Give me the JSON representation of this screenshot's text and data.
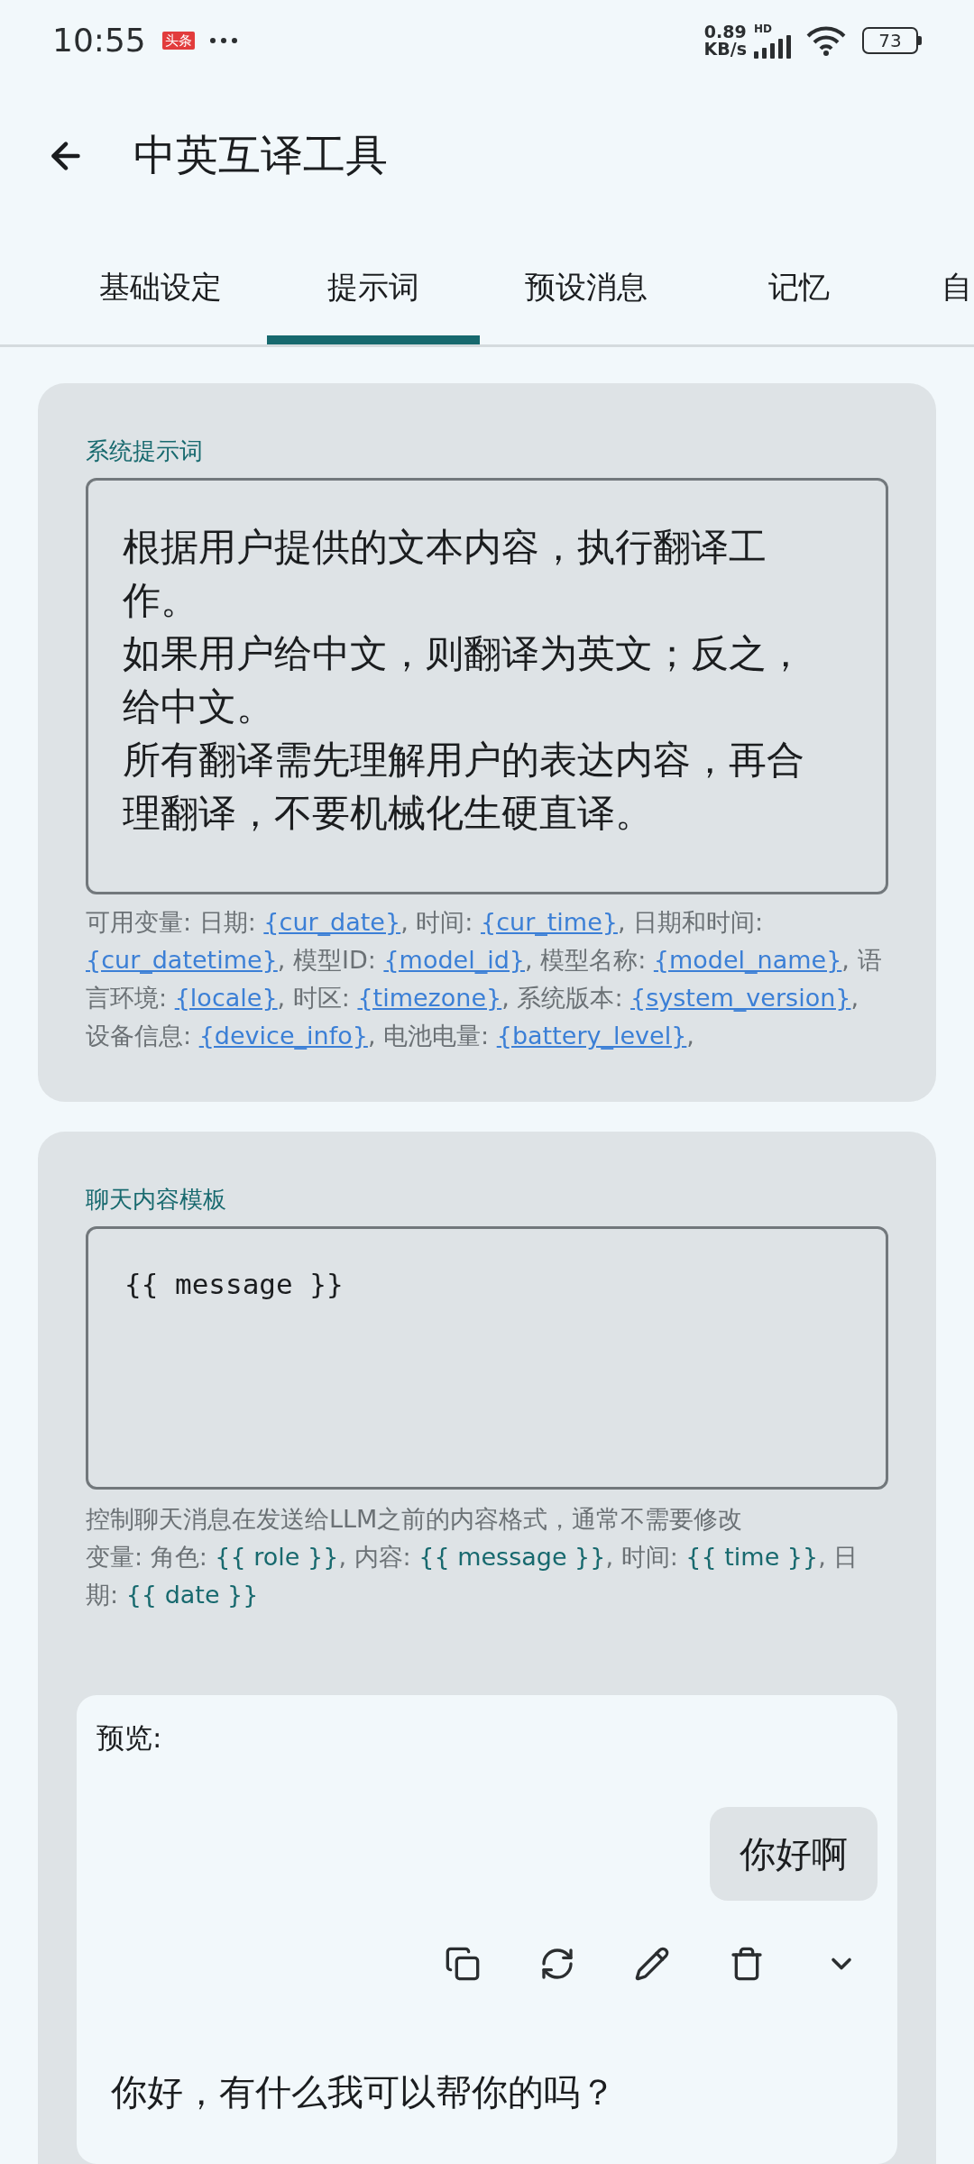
{
  "status_bar": {
    "time": "10:55",
    "app_badge": "头条",
    "net_speed_value": "0.89",
    "net_speed_unit": "KB/s",
    "network_type": "HD",
    "battery": "73"
  },
  "app_bar": {
    "title": "中英互译工具"
  },
  "tabs": [
    {
      "label": "基础设定",
      "selected": false
    },
    {
      "label": "提示词",
      "selected": true
    },
    {
      "label": "预设消息",
      "selected": false
    },
    {
      "label": "记忆",
      "selected": false
    },
    {
      "label": "自",
      "selected": false
    }
  ],
  "system_prompt": {
    "label": "系统提示词",
    "value": [
      "根据用户提供的文本内容，执行翻译工作。",
      "如果用户给中文，则翻译为英文；反之，给中文。",
      "所有翻译需先理解用户的表达内容，再合理翻译，不要机械化生硬直译。"
    ],
    "variables_help": [
      {
        "kind": "text",
        "text": "可用变量: 日期: "
      },
      {
        "kind": "link",
        "text": "{cur_date}"
      },
      {
        "kind": "text",
        "text": ", 时间: "
      },
      {
        "kind": "link",
        "text": "{cur_time}"
      },
      {
        "kind": "text",
        "text": ", 日期和时间: "
      },
      {
        "kind": "link",
        "text": "{cur_datetime}"
      },
      {
        "kind": "text",
        "text": ", 模型ID: "
      },
      {
        "kind": "link",
        "text": "{model_id}"
      },
      {
        "kind": "text",
        "text": ", 模型名称: "
      },
      {
        "kind": "link",
        "text": "{model_name}"
      },
      {
        "kind": "text",
        "text": ", 语言环境: "
      },
      {
        "kind": "link",
        "text": "{locale}"
      },
      {
        "kind": "text",
        "text": ", 时区: "
      },
      {
        "kind": "link",
        "text": "{timezone}"
      },
      {
        "kind": "text",
        "text": ", 系统版本: "
      },
      {
        "kind": "link",
        "text": "{system_version}"
      },
      {
        "kind": "text",
        "text": ", 设备信息: "
      },
      {
        "kind": "link",
        "text": "{device_info}"
      },
      {
        "kind": "text",
        "text": ", 电池电量: "
      },
      {
        "kind": "link",
        "text": "{battery_level}"
      },
      {
        "kind": "text",
        "text": ","
      }
    ]
  },
  "chat_template": {
    "label": "聊天内容模板",
    "value": "{{ message }}",
    "description": "控制聊天消息在发送给LLM之前的内容格式，通常不需要修改",
    "variables_help": [
      {
        "kind": "text",
        "text": "变量: 角色: "
      },
      {
        "kind": "var",
        "text": "{{ role }}"
      },
      {
        "kind": "text",
        "text": ", 内容: "
      },
      {
        "kind": "var",
        "text": "{{ message }}"
      },
      {
        "kind": "text",
        "text": ", 时间: "
      },
      {
        "kind": "var",
        "text": "{{ time }}"
      },
      {
        "kind": "text",
        "text": ", 日期: "
      },
      {
        "kind": "var",
        "text": "{{ date }}"
      }
    ]
  },
  "preview": {
    "label": "预览:",
    "user_message": "你好啊",
    "assistant_message": "你好，有什么我可以帮你的吗？"
  }
}
